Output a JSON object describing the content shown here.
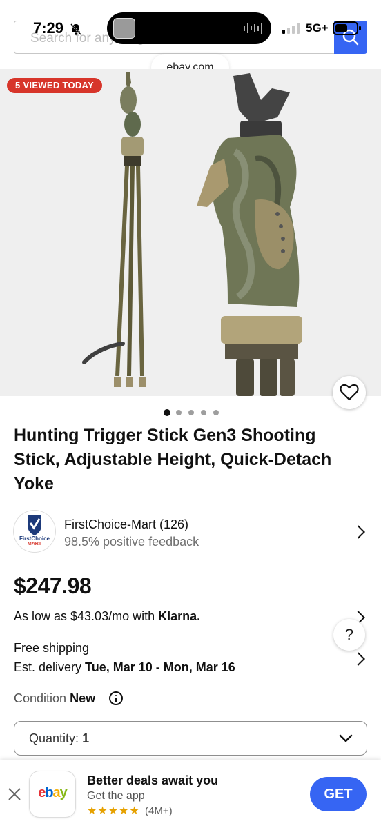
{
  "status_bar": {
    "time": "7:29",
    "network": "5G+"
  },
  "browser": {
    "search_placeholder": "Search for anything",
    "url": "ebay.com"
  },
  "hero": {
    "badge": "5 VIEWED TODAY"
  },
  "carousel": {
    "count": 5,
    "active": 0
  },
  "listing": {
    "title": "Hunting Trigger Stick Gen3 Shooting Stick, Adjustable Height, Quick-Detach Yoke",
    "price": "$247.98",
    "klarna_text": "As low as $43.03/mo with ",
    "klarna_brand": "Klarna.",
    "shipping": "Free shipping",
    "delivery_prefix": "Est. delivery ",
    "delivery_dates": "Tue, Mar 10 - Mon, Mar 16",
    "condition_label": "Condition",
    "condition_value": "New",
    "quantity_label": "Quantity:",
    "quantity_value": "1"
  },
  "seller": {
    "name": "FirstChoice-Mart (126)",
    "feedback": "98.5% positive feedback",
    "logo_text_1": "FirstChoice",
    "logo_text_2": "MART"
  },
  "help": {
    "label": "?"
  },
  "app_banner": {
    "icon_text": "ebay",
    "title": "Better deals await you",
    "subtitle": "Get the app",
    "stars": "★★★★★",
    "reviews": "(4M+)",
    "button": "GET"
  },
  "colors": {
    "brand_blue": "#3665f3",
    "badge_red": "#d7352a",
    "ebay_red": "#e53238",
    "ebay_blue": "#0064d2",
    "ebay_yellow": "#f5af02",
    "ebay_green": "#86b817"
  }
}
